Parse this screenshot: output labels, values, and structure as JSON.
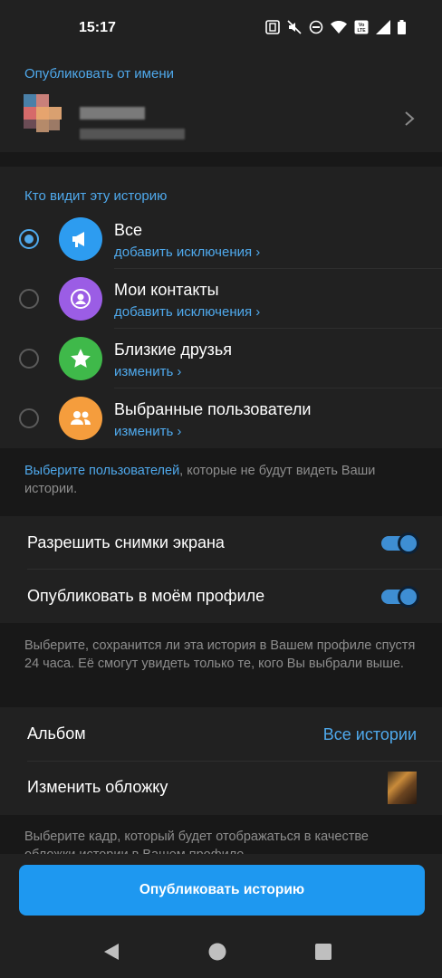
{
  "status_bar": {
    "time": "15:17",
    "icons": [
      "nfc-icon",
      "mute-icon",
      "dnd-icon",
      "wifi-icon",
      "volte-icon",
      "signal-icon",
      "battery-icon"
    ]
  },
  "publish_as": {
    "title": "Опубликовать от имени"
  },
  "audience": {
    "title": "Кто видит эту историю",
    "options": [
      {
        "label": "Все",
        "sub": "добавить исключения",
        "selected": true,
        "icon": "megaphone-icon",
        "color": "#2d9cf0"
      },
      {
        "label": "Мои контакты",
        "sub": "добавить исключения",
        "selected": false,
        "icon": "person-icon",
        "color": "#9b5de5"
      },
      {
        "label": "Близкие друзья",
        "sub": "изменить",
        "selected": false,
        "icon": "star-icon",
        "color": "#3fb94a"
      },
      {
        "label": "Выбранные пользователи",
        "sub": "изменить",
        "selected": false,
        "icon": "group-icon",
        "color": "#f59d3d"
      }
    ],
    "note_link": "Выберите пользователей",
    "note_rest": ", которые не будут видеть Ваши истории."
  },
  "settings": {
    "allow_screenshots": {
      "label": "Разрешить снимки экрана",
      "on": true
    },
    "post_to_profile": {
      "label": "Опубликовать в моём профиле",
      "on": true
    },
    "note": "Выберите, сохранится ли эта история в Вашем профиле спустя 24 часа. Её смогут увидеть только те, кого Вы выбрали выше."
  },
  "album": {
    "label": "Альбом",
    "value": "Все истории",
    "cover_label": "Изменить обложку",
    "cover_note": "Выберите кадр, который будет отображаться в качестве обложки истории в Вашем профиле."
  },
  "publish_button": "Опубликовать историю",
  "accent_color": "#4fa9ec"
}
